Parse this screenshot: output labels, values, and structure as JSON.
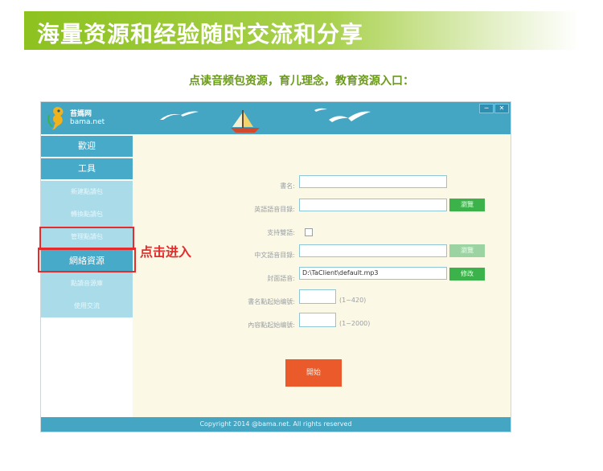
{
  "banner": {
    "title": "海量资源和经验随时交流和分享"
  },
  "subtitle": "点读音频包资源，育儿理念，教育资源入口：",
  "app": {
    "logo": {
      "name": "苔媽网",
      "domain": "bama.net",
      "icon": "seahorse-logo-icon"
    },
    "window_buttons": [
      "─",
      "✕"
    ],
    "sidebar": {
      "main_items": [
        "歡迎",
        "工具"
      ],
      "sub_items": [
        "新建點讀包",
        "轉換點讀包",
        "管理點讀包"
      ],
      "active_item": "網絡資源",
      "sub_items_2": [
        "點讀音源庫",
        "使用交流"
      ]
    },
    "form": {
      "book_name_label": "書名:",
      "book_name_value": "",
      "english_dir_label": "英語語音目錄:",
      "english_dir_value": "",
      "browse_label": "瀏覽",
      "bilingual_label": "支持雙語:",
      "chinese_dir_label": "中文語音目錄:",
      "chinese_dir_value": "",
      "cover_audio_label": "封面語音:",
      "cover_audio_value": "D:\\TaClient\\default.mp3",
      "modify_label": "修改",
      "title_start_label": "書名點起始编號:",
      "title_start_hint": "(1~420)",
      "content_start_label": "內容點起始编號:",
      "content_start_hint": "(1~2000)",
      "start_button": "開始"
    },
    "footer": "Copyright  2014 @bama.net. All rights reserved",
    "colors": {
      "topbar": "#45a6c3",
      "accent_green": "#3bb34a",
      "start": "#ea5a2a",
      "highlight": "#e52b2b"
    }
  },
  "callout": "点击进入"
}
